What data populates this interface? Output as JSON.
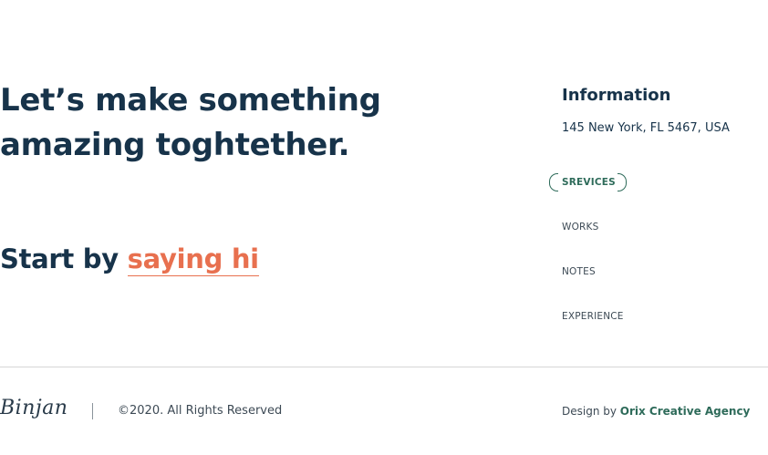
{
  "hero": {
    "headline_line1": "Let’s make something",
    "headline_line2": "amazing toghtether.",
    "start_prefix": "Start by ",
    "start_link": "saying hi"
  },
  "info": {
    "title": "Information",
    "address": "145 New York, FL 5467, USA"
  },
  "nav": {
    "items": [
      {
        "label": "SREVICES",
        "active": true
      },
      {
        "label": "WORKS",
        "active": false
      },
      {
        "label": "NOTES",
        "active": false
      },
      {
        "label": "EXPERIENCE",
        "active": false
      }
    ]
  },
  "footer": {
    "signature": "Binjan",
    "copyright": "©2020. All Rights Reserved",
    "credit_prefix": "Design by ",
    "credit_agency": "Orix Creative Agency"
  },
  "colors": {
    "heading": "#17334a",
    "accent_orange": "#e8704f",
    "accent_green": "#2e6b5a",
    "body_text": "#3d4a55",
    "divider": "#d6d6d6"
  }
}
